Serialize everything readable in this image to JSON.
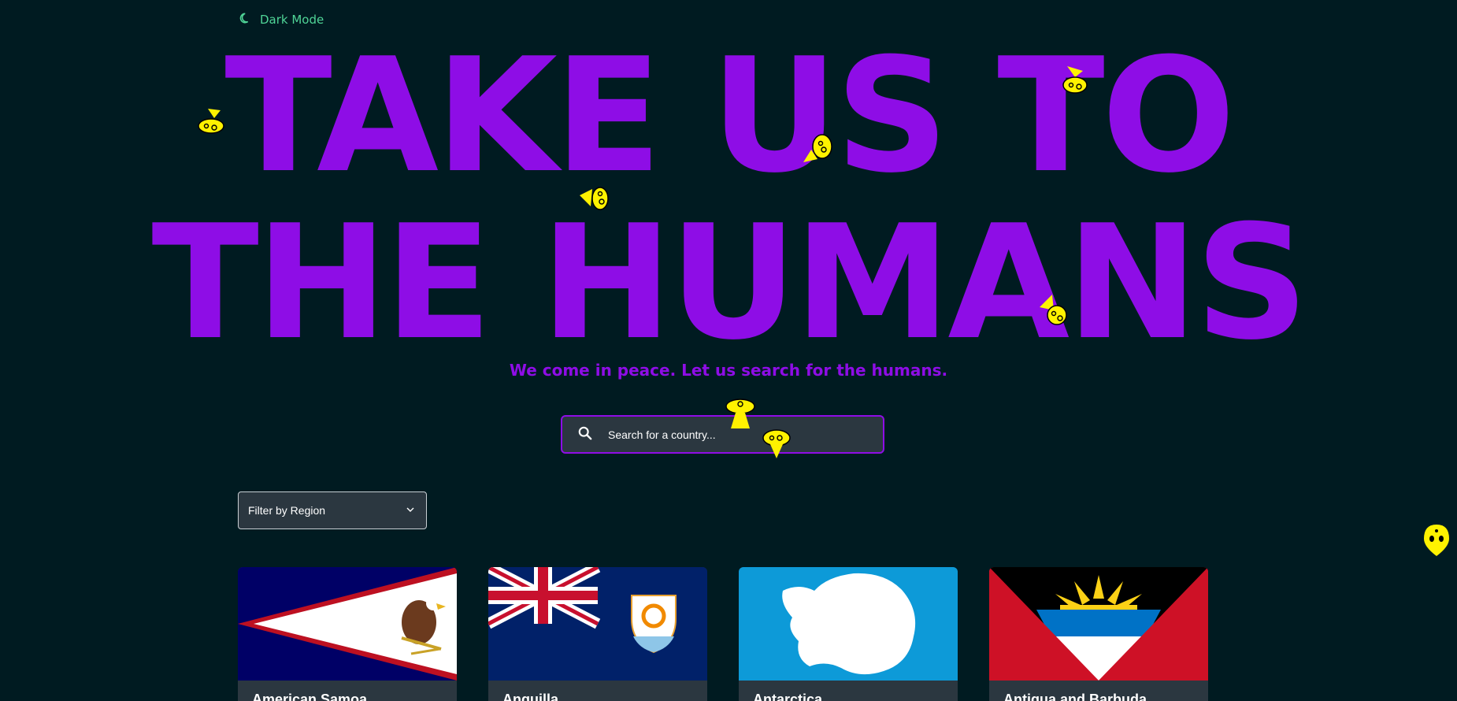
{
  "theme_toggle": {
    "label": "Dark Mode",
    "icon": "moon-icon",
    "color": "#4fd497"
  },
  "hero": {
    "title_line1": "TAKE US TO",
    "title_line2": "THE HUMANS",
    "tagline": "We come in peace. Let us search for the humans.",
    "accent": "#8e0de6"
  },
  "search": {
    "placeholder": "Search for a country...",
    "icon": "search-icon"
  },
  "filter": {
    "label": "Filter by Region",
    "icon": "chevron-down-icon"
  },
  "countries": [
    {
      "name": "American Samoa",
      "flag": "american-samoa-flag"
    },
    {
      "name": "Anguilla",
      "flag": "anguilla-flag"
    },
    {
      "name": "Antarctica",
      "flag": "antarctica-flag"
    },
    {
      "name": "Antigua and Barbuda",
      "flag": "antigua-and-barbuda-flag"
    }
  ],
  "decorations": {
    "ufo_color": "#fff200",
    "icon": "ufo-icon"
  }
}
